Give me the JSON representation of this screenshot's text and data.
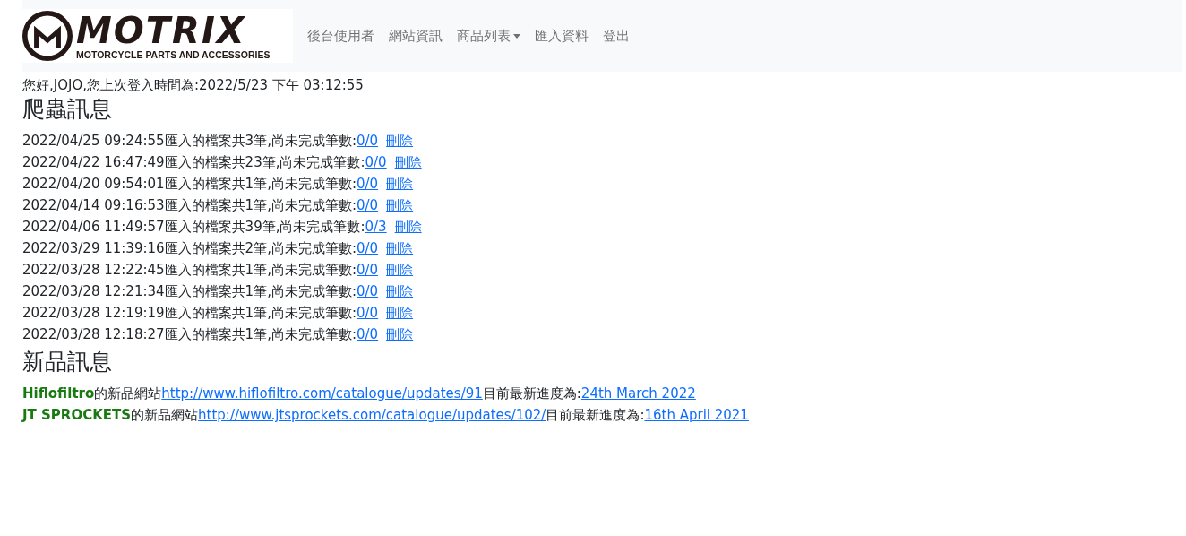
{
  "navbar": {
    "logo": {
      "wordmark": "MOTRIX",
      "tagline": "MOTORCYCLE PARTS AND ACCESSORIES"
    },
    "items": [
      {
        "label": "後台使用者",
        "kind": "link"
      },
      {
        "label": "網站資訊",
        "kind": "link"
      },
      {
        "label": "商品列表",
        "kind": "dropdown"
      },
      {
        "label": "匯入資料",
        "kind": "link"
      },
      {
        "label": "登出",
        "kind": "link"
      }
    ]
  },
  "greeting": "您好,JOJO,您上次登入時間為:2022/5/23 下午 03:12:55",
  "crawler_section": {
    "title": "爬蟲訊息",
    "entries": [
      {
        "text": "2022/04/25 09:24:55匯入的檔案共3筆,尚未完成筆數:",
        "progress": "0/0",
        "action": "刪除"
      },
      {
        "text": "2022/04/22 16:47:49匯入的檔案共23筆,尚未完成筆數:",
        "progress": "0/0",
        "action": "刪除"
      },
      {
        "text": "2022/04/20 09:54:01匯入的檔案共1筆,尚未完成筆數:",
        "progress": "0/0",
        "action": "刪除"
      },
      {
        "text": "2022/04/14 09:16:53匯入的檔案共1筆,尚未完成筆數:",
        "progress": "0/0",
        "action": "刪除"
      },
      {
        "text": "2022/04/06 11:49:57匯入的檔案共39筆,尚未完成筆數:",
        "progress": "0/3",
        "action": "刪除"
      },
      {
        "text": "2022/03/29 11:39:16匯入的檔案共2筆,尚未完成筆數:",
        "progress": "0/0",
        "action": "刪除"
      },
      {
        "text": "2022/03/28 12:22:45匯入的檔案共1筆,尚未完成筆數:",
        "progress": "0/0",
        "action": "刪除"
      },
      {
        "text": "2022/03/28 12:21:34匯入的檔案共1筆,尚未完成筆數:",
        "progress": "0/0",
        "action": "刪除"
      },
      {
        "text": "2022/03/28 12:19:19匯入的檔案共1筆,尚未完成筆數:",
        "progress": "0/0",
        "action": "刪除"
      },
      {
        "text": "2022/03/28 12:18:27匯入的檔案共1筆,尚未完成筆數:",
        "progress": "0/0",
        "action": "刪除"
      }
    ]
  },
  "new_products_section": {
    "title": "新品訊息",
    "entries": [
      {
        "brand": "Hiflofiltro",
        "label": "的新品網站",
        "url": "http://www.hiflofiltro.com/catalogue/updates/91",
        "progress_label": "目前最新進度為:",
        "date": "24th March 2022"
      },
      {
        "brand": "JT SPROCKETS",
        "label": "的新品網站",
        "url": "http://www.jtsprockets.com/catalogue/updates/102/",
        "progress_label": "目前最新進度為:",
        "date": "16th April 2021"
      }
    ]
  }
}
